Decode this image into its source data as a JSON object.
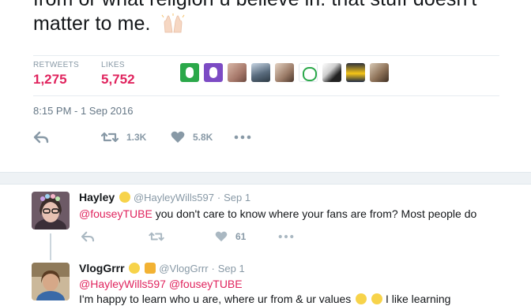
{
  "tweet": {
    "text_line1": "from or what religion u believe in. that stuff doesn't",
    "text_line2": "matter to me.",
    "stats": {
      "retweets_label": "RETWEETS",
      "retweets_value": "1,275",
      "likes_label": "LIKES",
      "likes_value": "5,752"
    },
    "timestamp": "8:15 PM - 1 Sep 2016",
    "actions": {
      "retweet_count": "1.3K",
      "like_count": "5.8K"
    }
  },
  "replies": [
    {
      "display_name": "Hayley",
      "handle": "@HayleyWills597",
      "separator": "·",
      "time": "Sep 1",
      "mention": "@fouseyTUBE",
      "text": " you don't care to know where your fans are from? Most people do",
      "like_count": "61"
    },
    {
      "display_name": "VlogGrrr",
      "handle": "@VlogGrrr",
      "separator": "·",
      "time": "Sep 1",
      "mention1": "@HayleyWills597",
      "mention2": "@fouseyTUBE",
      "text_line2": "I'm happy to learn who u are, where ur from & ur values",
      "text_line2_end": "I like learning"
    }
  ],
  "colors": {
    "accent_pink": "#e0245e",
    "muted": "#8899a6"
  },
  "icons": [
    "raised-hands-emoji",
    "reply-icon",
    "retweet-icon",
    "heart-icon",
    "more-icon",
    "chick-emoji",
    "muscle-emoji"
  ]
}
